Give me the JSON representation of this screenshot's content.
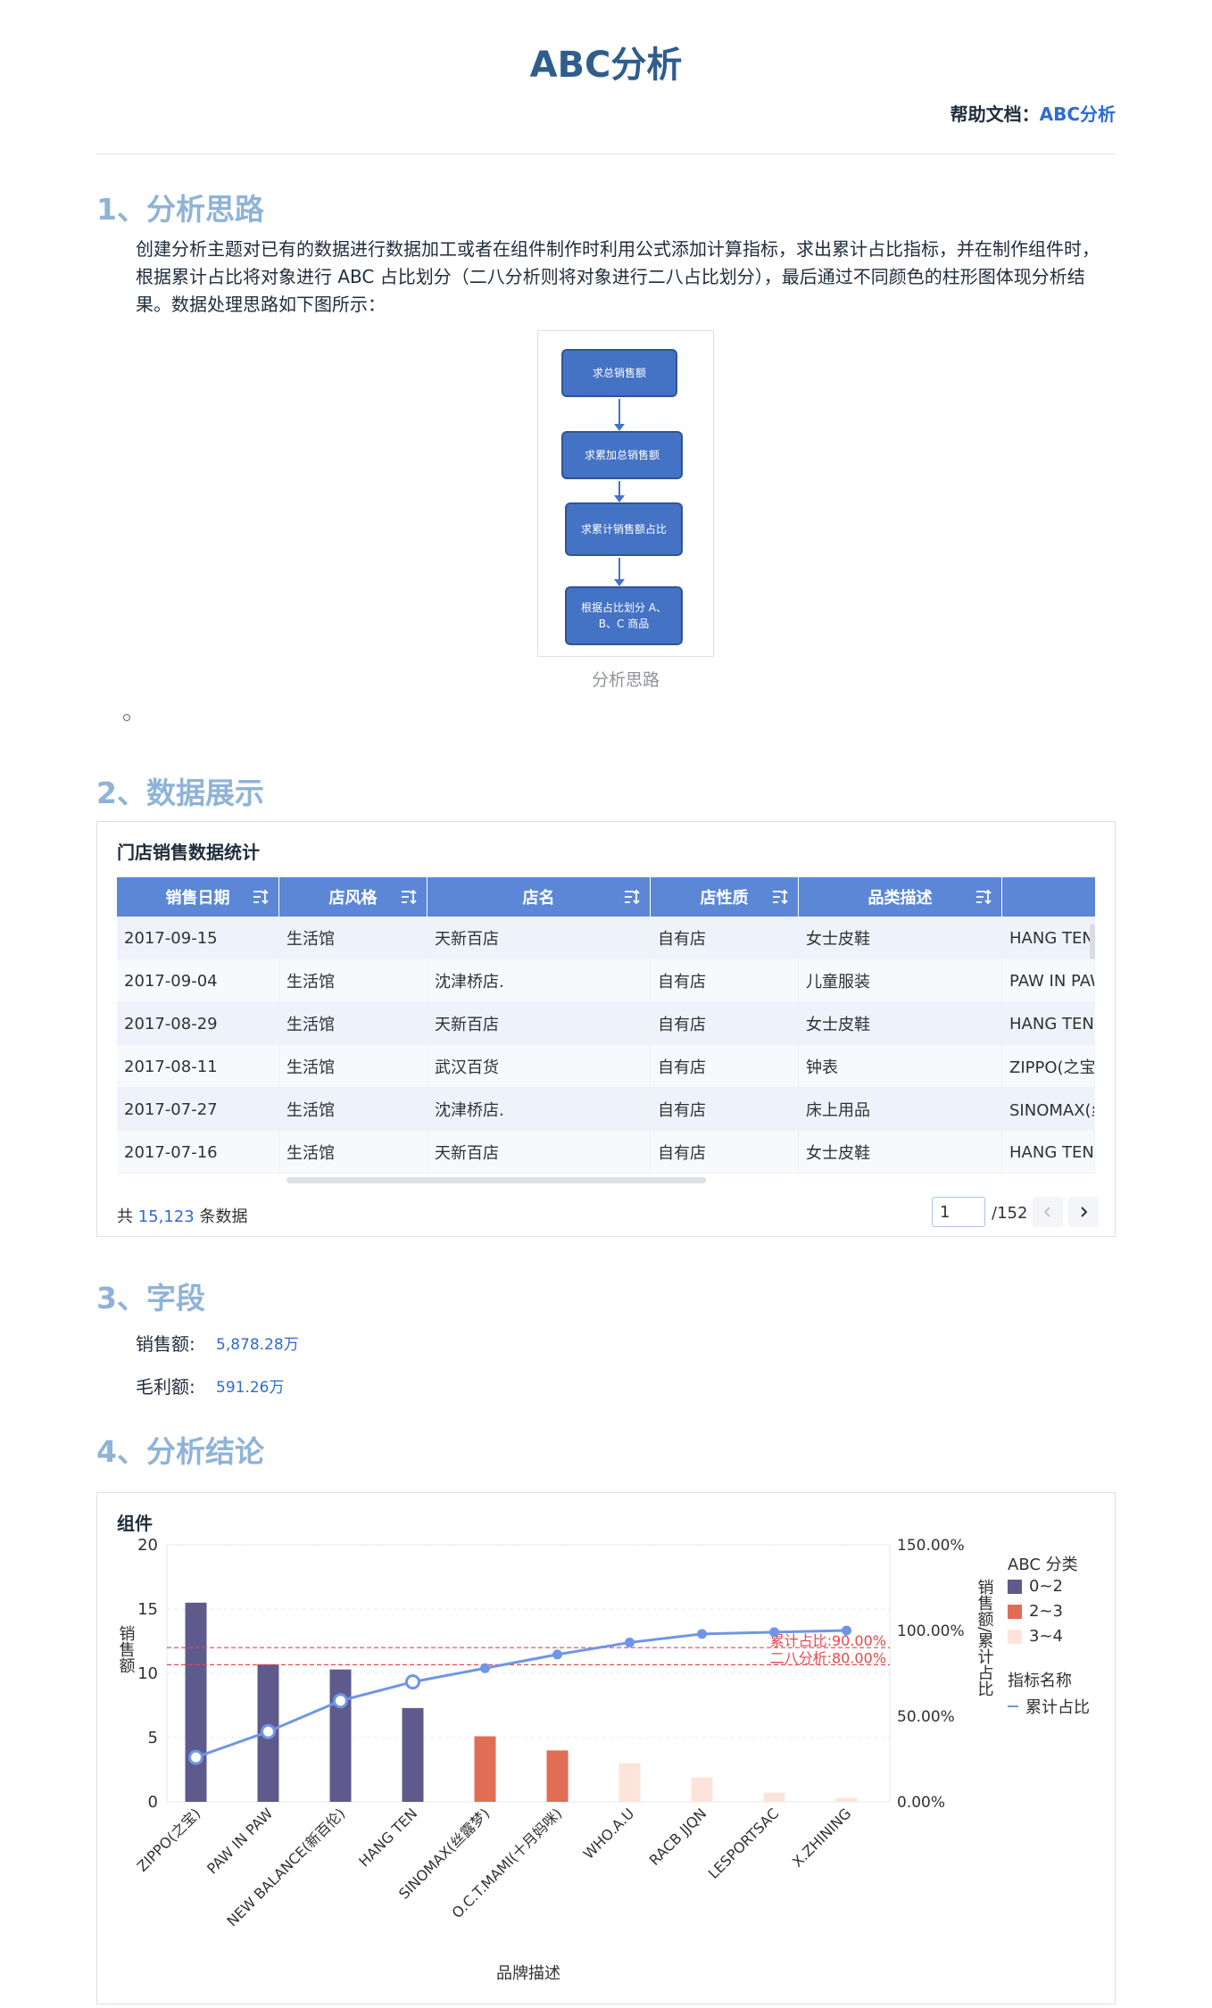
{
  "header": {
    "title": "ABC分析",
    "help_label": "帮助文档：",
    "help_link": "ABC分析"
  },
  "sections": {
    "s1": "1、分析思路",
    "s2": "2、数据展示",
    "s3": "3、字段",
    "s4": "4、分析结论"
  },
  "intro_text": "创建分析主题对已有的数据进行数据加工或者在组件制作时利用公式添加计算指标，求出累计占比指标，并在制作组件时，根据累计占比将对象进行 ABC 占比划分（二八分析则将对象进行二八占比划分），最后通过不同颜色的柱形图体现分析结果。数据处理思路如下图所示：",
  "flow": {
    "nodes": [
      "求总销售额",
      "求累加总销售额",
      "求累计销售额占比",
      "根据占比划分 A、B、C 商品"
    ],
    "caption": "分析思路"
  },
  "table": {
    "title": "门店销售数据统计",
    "columns": [
      "销售日期",
      "店风格",
      "店名",
      "店性质",
      "品类描述",
      ""
    ],
    "rows": [
      [
        "2017-09-15",
        "生活馆",
        "天新百店",
        "自有店",
        "女士皮鞋",
        "HANG TEN"
      ],
      [
        "2017-09-04",
        "生活馆",
        "沈津桥店.",
        "自有店",
        "儿童服装",
        "PAW IN PAW"
      ],
      [
        "2017-08-29",
        "生活馆",
        "天新百店",
        "自有店",
        "女士皮鞋",
        "HANG TEN"
      ],
      [
        "2017-08-11",
        "生活馆",
        "武汉百货",
        "自有店",
        "钟表",
        "ZIPPO(之宝)"
      ],
      [
        "2017-07-27",
        "生活馆",
        "沈津桥店.",
        "自有店",
        "床上用品",
        "SINOMAX(丝"
      ],
      [
        "2017-07-16",
        "生活馆",
        "天新百店",
        "自有店",
        "女士皮鞋",
        "HANG TEN"
      ]
    ],
    "pager": {
      "prefix": "共",
      "total": "15,123",
      "suffix": "条数据",
      "current_page": "1",
      "total_pages": "/152"
    }
  },
  "fields": [
    {
      "label": "销售额:",
      "value": "5,878.28万"
    },
    {
      "label": "毛利额:",
      "value": "591.26万"
    }
  ],
  "chart_card_title": "组件",
  "colors": {
    "abc_a": "#5e5b8c",
    "abc_b": "#e06e55",
    "abc_c": "#fde4da",
    "line": "#6f95e6",
    "ref_line": "#e5484d",
    "header_blue": "#5b87d6"
  },
  "chart_data": {
    "type": "bar",
    "categories": [
      "ZIPPO(之宝)",
      "PAW IN PAW",
      "NEW BALANCE(新百伦)",
      "HANG TEN",
      "SINOMAX(丝露梦)",
      "O.C.T.MAMI(十月妈咪)",
      "WHO.A.U",
      "RACB JJQN",
      "LESPORTSAC",
      "X.ZHINING"
    ],
    "series": [
      {
        "name": "累计占比",
        "type": "line",
        "axis": "right",
        "values": [
          0.26,
          0.41,
          0.59,
          0.7,
          0.78,
          0.86,
          0.93,
          0.98,
          0.99,
          1.0
        ]
      }
    ],
    "bars": {
      "values": [
        15.5,
        10.7,
        10.3,
        7.3,
        5.1,
        4.0,
        3.0,
        1.9,
        0.7,
        0.3
      ],
      "abc_class": [
        "0~2",
        "0~2",
        "0~2",
        "0~2",
        "2~3",
        "2~3",
        "3~4",
        "3~4",
        "3~4",
        "3~4"
      ]
    },
    "reference_lines": [
      {
        "label": "累计占比:90.00%",
        "value": 0.9
      },
      {
        "label": "二八分析:80.00%",
        "value": 0.8
      }
    ],
    "xlabel": "品牌描述",
    "ylabel": "销售额",
    "y2label": "销售额/累计占比",
    "left_ticks": [
      "20",
      "15",
      "10",
      "5",
      "0"
    ],
    "right_ticks": [
      "150.00%",
      "100.00%",
      "50.00%",
      "0.00%"
    ],
    "ylim": [
      0,
      20
    ],
    "y2lim": [
      0,
      1.5
    ],
    "legend": {
      "title": "ABC 分类",
      "items": [
        "0~2",
        "2~3",
        "3~4"
      ],
      "measure_title": "指标名称",
      "measure_item": "累计占比"
    }
  }
}
